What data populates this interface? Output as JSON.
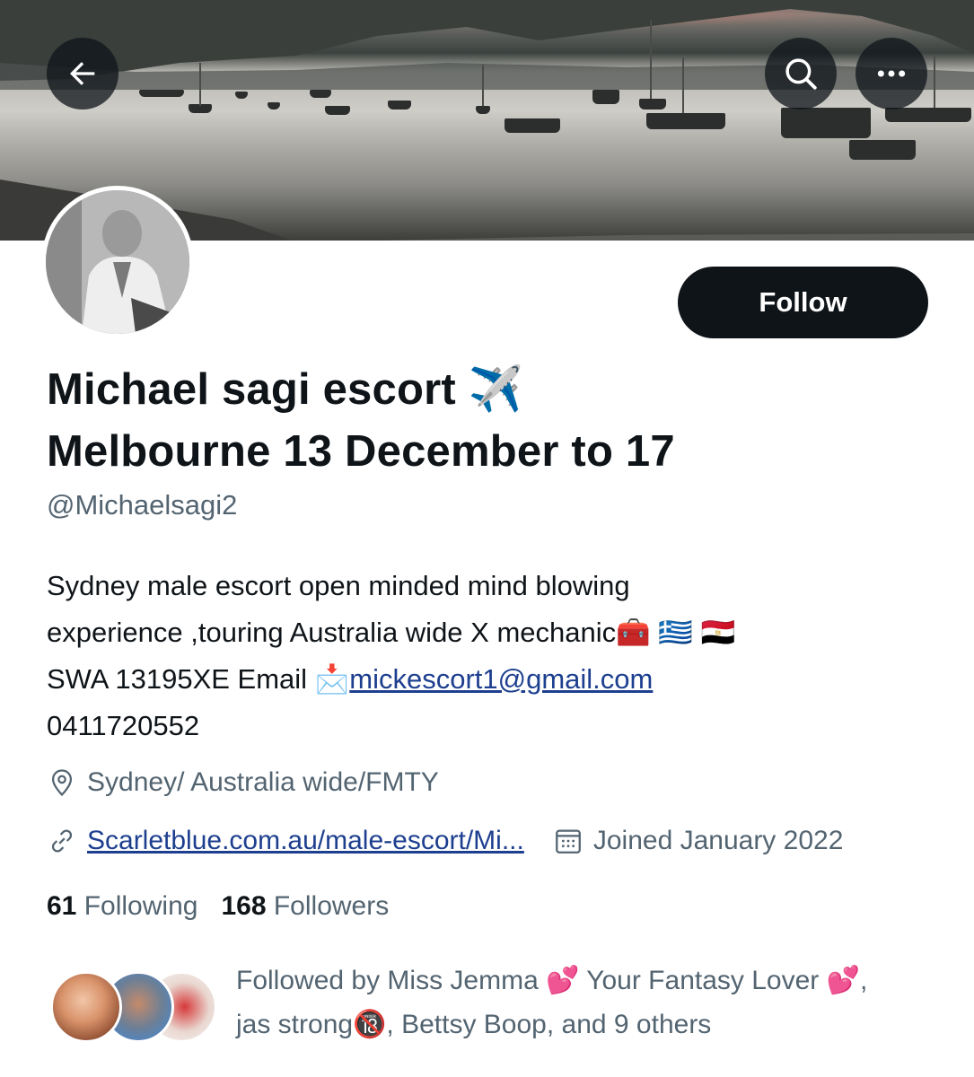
{
  "header": {
    "back_icon": "arrow-left-icon",
    "search_icon": "search-icon",
    "more_icon": "more-horizontal-icon"
  },
  "profile": {
    "follow_label": "Follow",
    "name_line1": "Michael sagi escort ✈️",
    "name_line2": "Melbourne 13 December to 17",
    "handle": "@Michaelsagi2",
    "bio": {
      "line1": "Sydney male escort open minded mind blowing",
      "line2": "experience ,touring Australia wide X mechanic🧰 🇬🇷 🇪🇬",
      "line3_prefix": "SWA 13195XE Email 📩",
      "email": "mickescort1@gmail.com",
      "line4": "0411720552"
    },
    "location": "Sydney/ Australia wide/FMTY",
    "url": "Scarletblue.com.au/male-escort/Mi...",
    "joined": "Joined January 2022",
    "following_count": "61",
    "following_label": "Following",
    "followers_count": "168",
    "followers_label": "Followers",
    "followed_by_line1": "Followed by Miss Jemma 💕  Your Fantasy Lover 💕,",
    "followed_by_line2": "jas strong🔞, Bettsy Boop, and 9 others"
  },
  "colors": {
    "text_primary": "#0f1419",
    "text_secondary": "#536471",
    "link": "#1d3f8f",
    "button_bg": "#0f1419"
  }
}
